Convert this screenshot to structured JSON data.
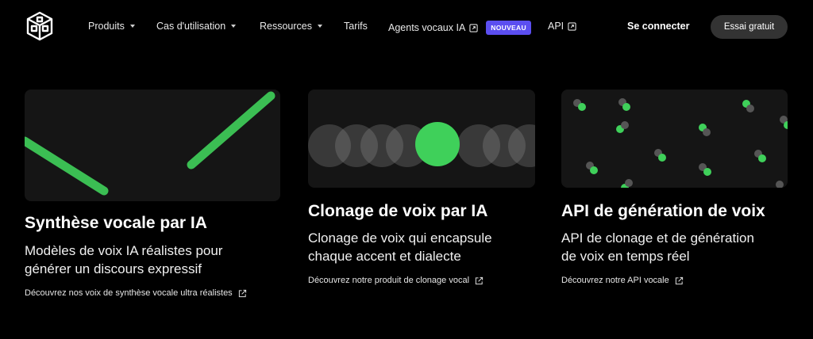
{
  "nav": {
    "items": [
      {
        "label": "Produits",
        "dropdown": true
      },
      {
        "label": "Cas d'utilisation",
        "dropdown": true
      },
      {
        "label": "Ressources",
        "dropdown": true
      },
      {
        "label": "Tarifs"
      },
      {
        "label": "Agents vocaux IA",
        "external": true,
        "badge": "NOUVEAU"
      },
      {
        "label": "API",
        "external": true
      }
    ],
    "login": "Se connecter",
    "cta": "Essai gratuit"
  },
  "cards": [
    {
      "title": "Synthèse vocale par IA",
      "desc_1": "Modèles de voix IA réalistes pour",
      "desc_2": "générer un discours expressif",
      "link": "Découvrez nos voix de synthèse vocale ultra réalistes"
    },
    {
      "title": "Clonage de voix par IA",
      "desc_1": "Clonage de voix qui encapsule",
      "desc_2": "chaque accent et dialecte",
      "link": "Découvrez notre produit de clonage vocal"
    },
    {
      "title": "API de génération de voix",
      "desc_1": "API de clonage et de génération",
      "desc_2": "de voix en temps réel",
      "link": "Découvrez notre API vocale"
    }
  ],
  "colors": {
    "accent_green": "#3fd05a",
    "badge_purple": "#5b4ef0",
    "background": "#000000"
  }
}
